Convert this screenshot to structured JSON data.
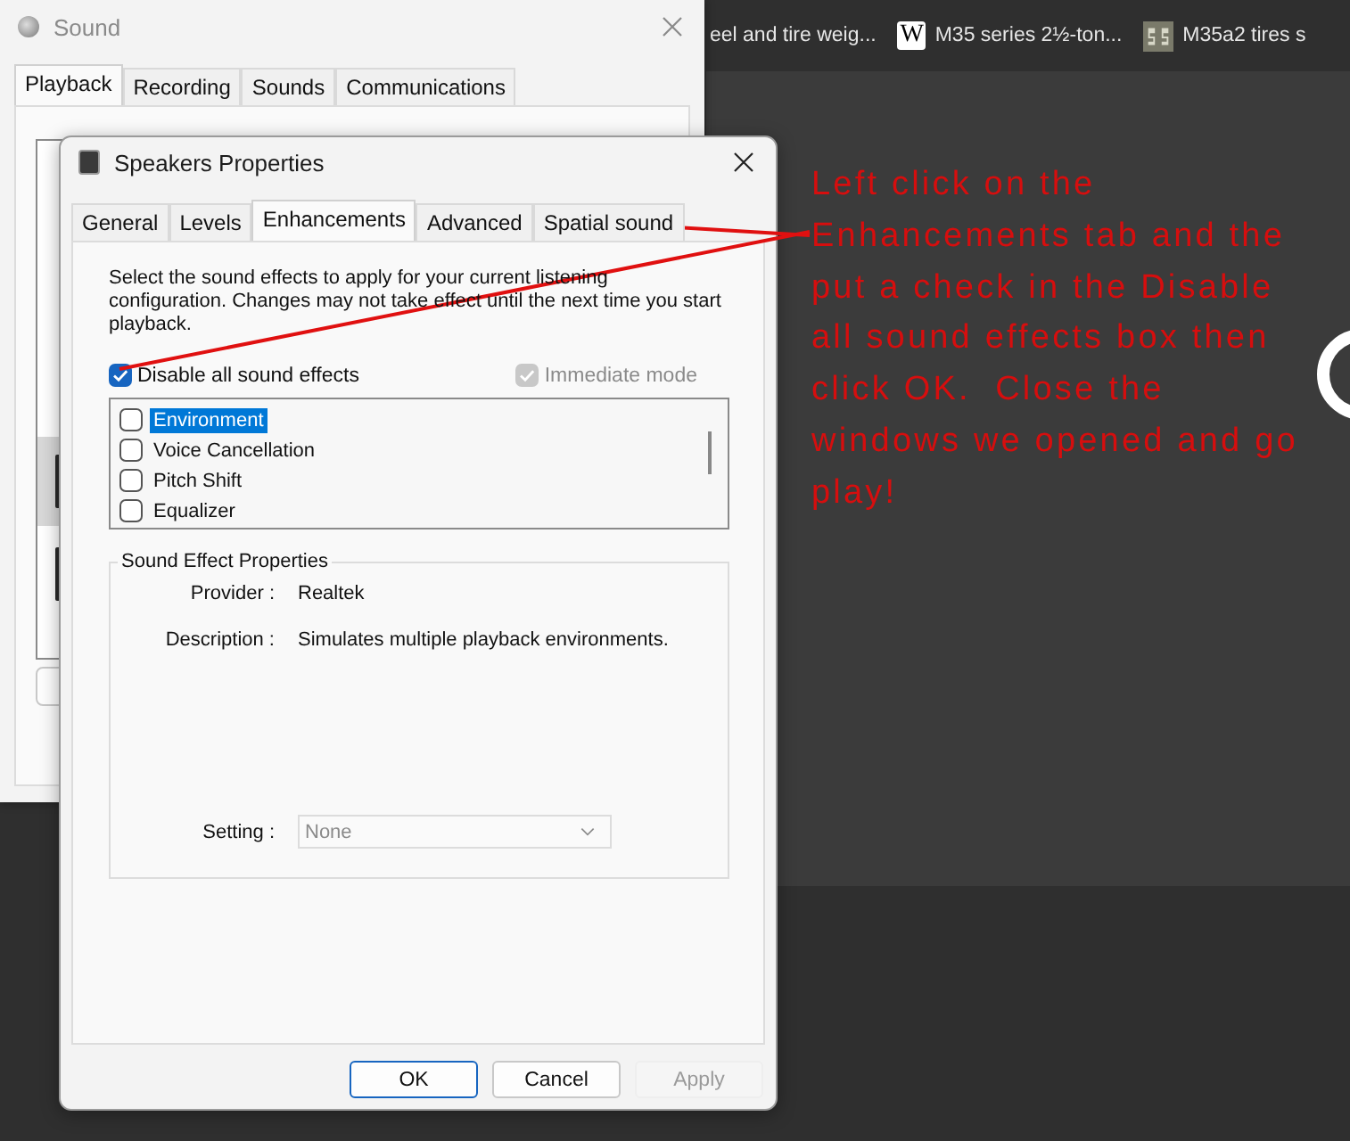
{
  "browser_tabs": [
    {
      "title": "eel and tire weig...",
      "kind": "plain"
    },
    {
      "title": "M35 series 2½-ton...",
      "kind": "letter",
      "badge": "W"
    },
    {
      "title": "M35a2 tires s",
      "kind": "image"
    }
  ],
  "sound_window": {
    "title": "Sound",
    "tabs": [
      {
        "label": "Playback",
        "selected": true
      },
      {
        "label": "Recording",
        "selected": false
      },
      {
        "label": "Sounds",
        "selected": false
      },
      {
        "label": "Communications",
        "selected": false
      }
    ]
  },
  "dialog": {
    "title": "Speakers Properties",
    "tabs": [
      {
        "label": "General",
        "selected": false
      },
      {
        "label": "Levels",
        "selected": false
      },
      {
        "label": "Enhancements",
        "selected": true
      },
      {
        "label": "Advanced",
        "selected": false
      },
      {
        "label": "Spatial sound",
        "selected": false
      }
    ],
    "intro": "Select the sound effects to apply for your current listening\nconfiguration. Changes may not take effect until the next time you start\nplayback.",
    "options": [
      {
        "label": "Disable all sound effects",
        "checked": true,
        "disabled": false
      },
      {
        "label": "Immediate mode",
        "checked": true,
        "disabled": true
      }
    ],
    "effects": [
      {
        "label": "Environment",
        "checked": false,
        "selected": true
      },
      {
        "label": "Voice Cancellation",
        "checked": false,
        "selected": false
      },
      {
        "label": "Pitch Shift",
        "checked": false,
        "selected": false
      },
      {
        "label": "Equalizer",
        "checked": false,
        "selected": false
      }
    ],
    "properties": {
      "title": "Sound Effect Properties",
      "rows": [
        {
          "label": "Provider :",
          "value": "Realtek"
        },
        {
          "label": "Description :",
          "value": "Simulates multiple playback environments."
        }
      ],
      "setting": {
        "label": "Setting :",
        "value": "None",
        "disabled": true
      }
    },
    "buttons": [
      {
        "label": "OK",
        "default": true,
        "disabled": false
      },
      {
        "label": "Cancel",
        "default": false,
        "disabled": false
      },
      {
        "label": "Apply",
        "default": false,
        "disabled": true
      }
    ]
  },
  "annotation": {
    "text": "Left click on the\nEnhancements tab and the\nput a check in the Disable\nall sound effects box then\nclick OK.  Close the\nwindows we opened and go\nplay!"
  }
}
